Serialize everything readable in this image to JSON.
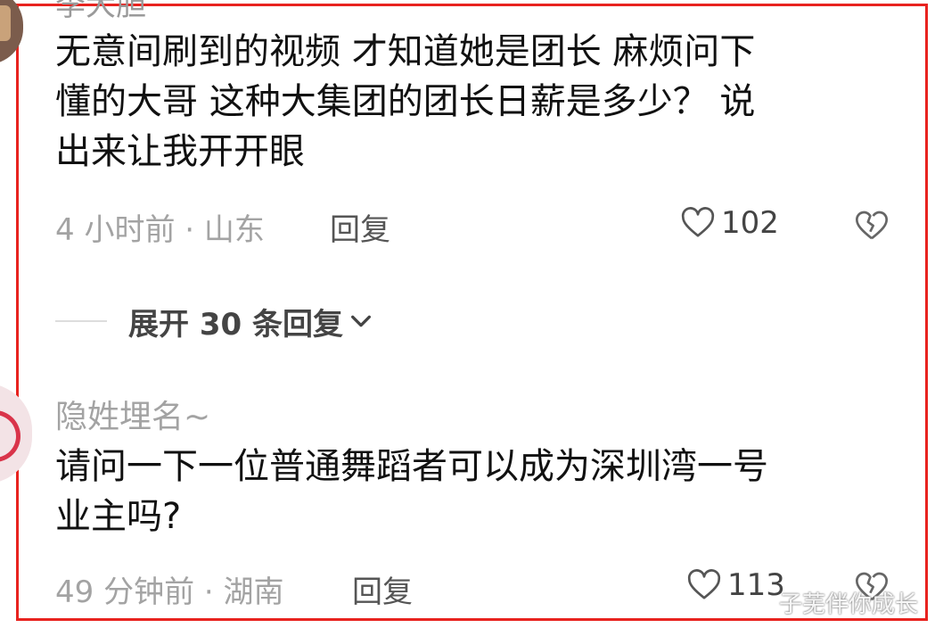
{
  "comment1": {
    "username": "李大胆",
    "text_lines": [
      "无意间刷到的视频 才知道她是团长   麻烦问下",
      "懂的大哥  这种大集团的团长日薪是多少？   说",
      "出来让我开开眼"
    ],
    "meta": "4 小时前 · 山东",
    "reply_label": "回复",
    "like_count": "102"
  },
  "expand": {
    "label": "展开 30 条回复"
  },
  "comment2": {
    "username": "隐姓埋名~",
    "text_lines": [
      "请问一下一位普通舞蹈者可以成为深圳湾一号",
      "业主吗?"
    ],
    "meta": "49 分钟前 · 湖南",
    "reply_label": "回复",
    "like_count": "113"
  },
  "watermark": "子芜伴你成长",
  "colors": {
    "highlight_border": "#e8231f",
    "meta_gray": "#a3a3a3"
  },
  "icons": [
    "avatar",
    "heart-icon",
    "broken-heart-icon",
    "chevron-down-icon"
  ]
}
